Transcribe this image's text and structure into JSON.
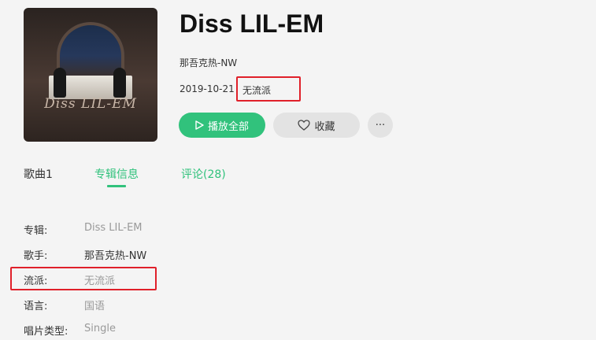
{
  "album": {
    "title": "Diss LIL-EM",
    "artist": "那吾克热-NW",
    "date": "2019-10-21",
    "genre": "无流派",
    "cover_text": "Diss LIL-EM"
  },
  "actions": {
    "play_all": "播放全部",
    "favorite": "收藏",
    "more": "···"
  },
  "tabs": [
    {
      "label": "歌曲1"
    },
    {
      "label": "专辑信息",
      "active": true
    },
    {
      "label": "评论(28)"
    }
  ],
  "info": [
    {
      "label": "专辑:",
      "value": "Diss LIL-EM"
    },
    {
      "label": "歌手:",
      "value": "那吾克热-NW"
    },
    {
      "label": "流派:",
      "value": "无流派"
    },
    {
      "label": "语言:",
      "value": "国语"
    },
    {
      "label": "唱片类型:",
      "value": "Single"
    }
  ],
  "colors": {
    "accent": "#31c27c",
    "highlight": "#e0202a",
    "background": "#f4f4f4"
  }
}
